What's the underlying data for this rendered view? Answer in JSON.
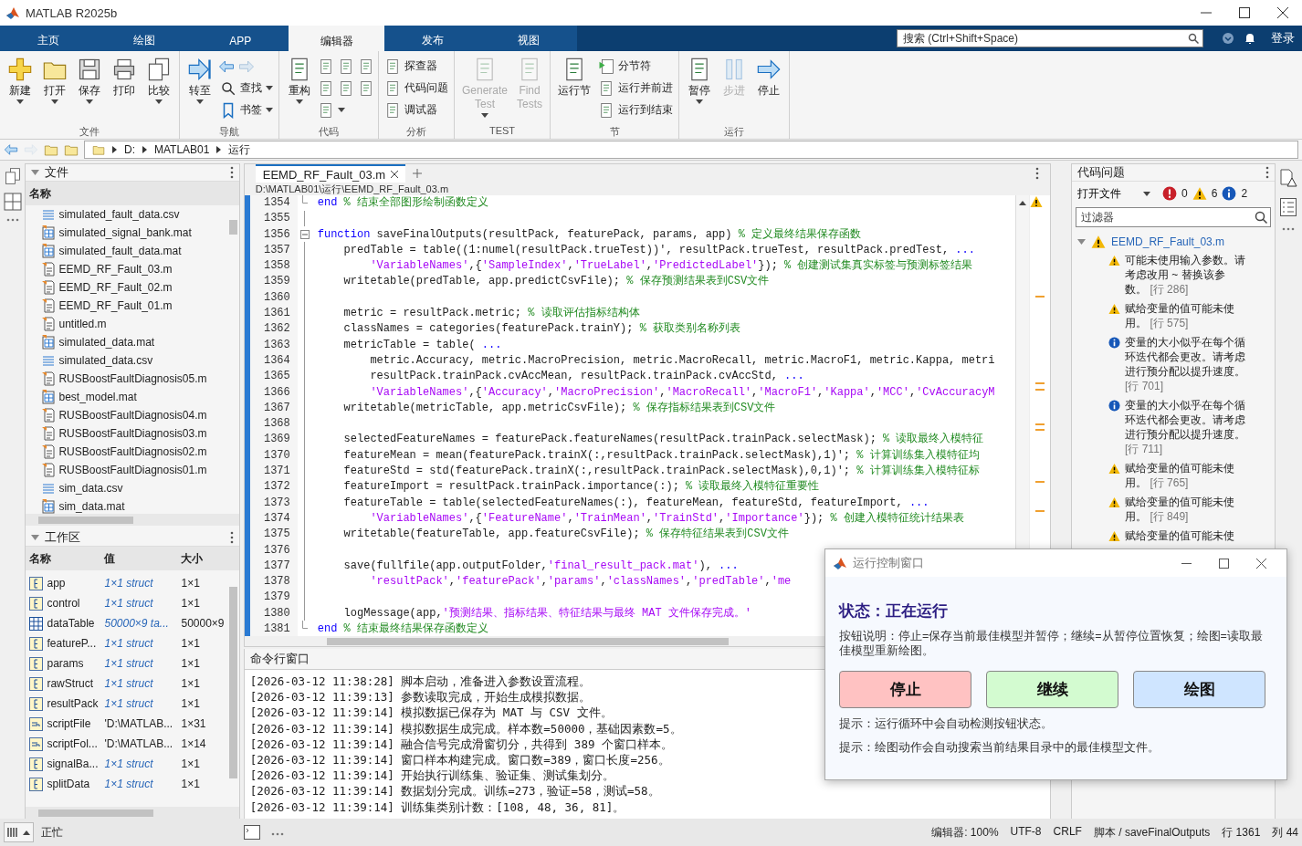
{
  "window": {
    "title": "MATLAB R2025b"
  },
  "tabs": [
    {
      "label": "主页",
      "selected": false
    },
    {
      "label": "绘图",
      "selected": false
    },
    {
      "label": "APP",
      "selected": false
    },
    {
      "label": "编辑器",
      "selected": true
    },
    {
      "label": "发布",
      "selected": false
    },
    {
      "label": "视图",
      "selected": false
    }
  ],
  "search": {
    "placeholder": "搜索 (Ctrl+Shift+Space)"
  },
  "login": "登录",
  "toolstrip": [
    {
      "label": "文件",
      "items": [
        {
          "kind": "big",
          "label": "新建",
          "dropdown": true,
          "disabled": false
        },
        {
          "kind": "big",
          "label": "打开",
          "dropdown": true,
          "disabled": false
        },
        {
          "kind": "big",
          "label": "保存",
          "dropdown": true,
          "disabled": false
        },
        {
          "kind": "big",
          "label": "打印",
          "dropdown": false,
          "disabled": false
        },
        {
          "kind": "big",
          "label": "比较",
          "dropdown": true,
          "disabled": false
        }
      ]
    },
    {
      "label": "导航",
      "items": [
        {
          "kind": "big",
          "label": "转至",
          "dropdown": true,
          "disabled": false
        },
        {
          "kind": "stack",
          "rows": [
            {
              "kind": "icon-pair"
            },
            {
              "kind": "small",
              "label": "查找",
              "dropdown": true
            },
            {
              "kind": "small",
              "label": "书签",
              "dropdown": true
            }
          ]
        }
      ]
    },
    {
      "label": "代码",
      "items": [
        {
          "kind": "big",
          "label": "重构",
          "dropdown": true,
          "disabled": false
        },
        {
          "kind": "stack",
          "rows": [
            {
              "kind": "icon-triple"
            },
            {
              "kind": "icon-triple"
            },
            {
              "kind": "icon-dropdown"
            }
          ]
        }
      ]
    },
    {
      "label": "分析",
      "items": [
        {
          "kind": "stack",
          "rows": [
            {
              "kind": "small",
              "label": "探查器",
              "dropdown": false
            },
            {
              "kind": "small",
              "label": "代码问题",
              "dropdown": false
            },
            {
              "kind": "small",
              "label": "调试器",
              "dropdown": false
            }
          ]
        }
      ]
    },
    {
      "label": "TEST",
      "items": [
        {
          "kind": "big",
          "label": "Generate Test",
          "dropdown": true,
          "disabled": true
        },
        {
          "kind": "big",
          "label": "Find Tests",
          "dropdown": false,
          "disabled": true
        }
      ]
    },
    {
      "label": "节",
      "items": [
        {
          "kind": "big",
          "label": "运行节",
          "dropdown": false,
          "disabled": false
        },
        {
          "kind": "stack",
          "rows": [
            {
              "kind": "small",
              "label": "分节符",
              "dropdown": false
            },
            {
              "kind": "small",
              "label": "运行并前进",
              "dropdown": false
            },
            {
              "kind": "small",
              "label": "运行到结束",
              "dropdown": false
            }
          ]
        }
      ]
    },
    {
      "label": "运行",
      "items": [
        {
          "kind": "big",
          "label": "暂停",
          "dropdown": true,
          "disabled": false
        },
        {
          "kind": "big",
          "label": "步进",
          "dropdown": false,
          "disabled": true
        },
        {
          "kind": "big",
          "label": "停止",
          "dropdown": false,
          "disabled": false
        }
      ]
    }
  ],
  "address": [
    "D:",
    "MATLAB01",
    "运行"
  ],
  "files": {
    "title": "文件",
    "column": "名称",
    "items": [
      {
        "name": "simulated_fault_data.csv",
        "kind": "csv"
      },
      {
        "name": "simulated_signal_bank.mat",
        "kind": "mat"
      },
      {
        "name": "simulated_fault_data.mat",
        "kind": "mat"
      },
      {
        "name": "EEMD_RF_Fault_03.m",
        "kind": "script"
      },
      {
        "name": "EEMD_RF_Fault_02.m",
        "kind": "script"
      },
      {
        "name": "EEMD_RF_Fault_01.m",
        "kind": "script"
      },
      {
        "name": "untitled.m",
        "kind": "script"
      },
      {
        "name": "simulated_data.mat",
        "kind": "mat"
      },
      {
        "name": "simulated_data.csv",
        "kind": "csv"
      },
      {
        "name": "RUSBoostFaultDiagnosis05.m",
        "kind": "script"
      },
      {
        "name": "best_model.mat",
        "kind": "mat"
      },
      {
        "name": "RUSBoostFaultDiagnosis04.m",
        "kind": "script"
      },
      {
        "name": "RUSBoostFaultDiagnosis03.m",
        "kind": "script"
      },
      {
        "name": "RUSBoostFaultDiagnosis02.m",
        "kind": "script"
      },
      {
        "name": "RUSBoostFaultDiagnosis01.m",
        "kind": "script"
      },
      {
        "name": "sim_data.csv",
        "kind": "csv"
      },
      {
        "name": "sim_data.mat",
        "kind": "mat"
      }
    ]
  },
  "workspace": {
    "title": "工作区",
    "columns": [
      "名称",
      "值",
      "大小"
    ],
    "rows": [
      {
        "name": "app",
        "value": "1×1 struct",
        "size": "1×1",
        "kind": "struct"
      },
      {
        "name": "control",
        "value": "1×1 struct",
        "size": "1×1",
        "kind": "struct"
      },
      {
        "name": "dataTable",
        "value": "50000×9 ta...",
        "size": "50000×9",
        "kind": "table"
      },
      {
        "name": "featureP...",
        "value": "1×1 struct",
        "size": "1×1",
        "kind": "struct"
      },
      {
        "name": "params",
        "value": "1×1 struct",
        "size": "1×1",
        "kind": "struct"
      },
      {
        "name": "rawStruct",
        "value": "1×1 struct",
        "size": "1×1",
        "kind": "struct"
      },
      {
        "name": "resultPack",
        "value": "1×1 struct",
        "size": "1×1",
        "kind": "struct"
      },
      {
        "name": "scriptFile",
        "value": "'D:\\MATLAB...",
        "size": "1×31",
        "kind": "char"
      },
      {
        "name": "scriptFol...",
        "value": "'D:\\MATLAB...",
        "size": "1×14",
        "kind": "char"
      },
      {
        "name": "signalBa...",
        "value": "1×1 struct",
        "size": "1×1",
        "kind": "struct"
      },
      {
        "name": "splitData",
        "value": "1×1 struct",
        "size": "1×1",
        "kind": "struct"
      }
    ]
  },
  "editor": {
    "tab": "EEMD_RF_Fault_03.m",
    "path": "D:\\MATLAB01\\运行\\EEMD_RF_Fault_03.m",
    "lines": [
      {
        "num": "1354",
        "kind": "block-end",
        "segs": [
          {
            "kind": "keyword",
            "text": "end"
          },
          {
            "kind": "comment",
            "text": " % 结束全部图形绘制函数定义"
          }
        ]
      },
      {
        "num": "1355",
        "kind": "blank"
      },
      {
        "num": "1356",
        "kind": "function-start",
        "segs": [
          {
            "kind": "keyword",
            "text": "function"
          },
          {
            "kind": "plain",
            "text": " saveFinalOutputs(resultPack, featurePack, params, app) "
          },
          {
            "kind": "comment",
            "text": "% 定义最终结果保存函数"
          }
        ]
      },
      {
        "num": "1357",
        "kind": "code",
        "segs": [
          {
            "kind": "plain",
            "text": "    predTable = table((1:numel(resultPack.trueTest))', resultPack.trueTest, resultPack.predTest, "
          },
          {
            "kind": "keyword",
            "text": "..."
          }
        ]
      },
      {
        "num": "1358",
        "kind": "code",
        "segs": [
          {
            "kind": "string",
            "text": "        'VariableNames'"
          },
          {
            "kind": "plain",
            "text": ",{"
          },
          {
            "kind": "string",
            "text": "'SampleIndex'"
          },
          {
            "kind": "plain",
            "text": ","
          },
          {
            "kind": "string",
            "text": "'TrueLabel'"
          },
          {
            "kind": "plain",
            "text": ","
          },
          {
            "kind": "string",
            "text": "'PredictedLabel'"
          },
          {
            "kind": "plain",
            "text": "}); "
          },
          {
            "kind": "comment",
            "text": "% 创建测试集真实标签与预测标签结果"
          }
        ]
      },
      {
        "num": "1359",
        "kind": "code",
        "segs": [
          {
            "kind": "plain",
            "text": "    writetable(predTable, app.predictCsvFile); "
          },
          {
            "kind": "comment",
            "text": "% 保存预测结果表到CSV文件"
          }
        ]
      },
      {
        "num": "1360",
        "kind": "blank"
      },
      {
        "num": "1361",
        "kind": "code",
        "segs": [
          {
            "kind": "plain",
            "text": "    metric = resultPack.metric; "
          },
          {
            "kind": "comment",
            "text": "% 读取评估指标结构体"
          }
        ]
      },
      {
        "num": "1362",
        "kind": "code",
        "segs": [
          {
            "kind": "plain",
            "text": "    classNames = categories(featurePack.trainY); "
          },
          {
            "kind": "comment",
            "text": "% 获取类别名称列表"
          }
        ]
      },
      {
        "num": "1363",
        "kind": "code",
        "segs": [
          {
            "kind": "plain",
            "text": "    metricTable = table( "
          },
          {
            "kind": "keyword",
            "text": "..."
          }
        ]
      },
      {
        "num": "1364",
        "kind": "code",
        "segs": [
          {
            "kind": "plain",
            "text": "        metric.Accuracy, metric.MacroPrecision, metric.MacroRecall, metric.MacroF1, metric.Kappa, metri"
          }
        ]
      },
      {
        "num": "1365",
        "kind": "code",
        "segs": [
          {
            "kind": "plain",
            "text": "        resultPack.trainPack.cvAccMean, resultPack.trainPack.cvAccStd, "
          },
          {
            "kind": "keyword",
            "text": "..."
          }
        ]
      },
      {
        "num": "1366",
        "kind": "code",
        "segs": [
          {
            "kind": "string",
            "text": "        'VariableNames'"
          },
          {
            "kind": "plain",
            "text": ",{"
          },
          {
            "kind": "string",
            "text": "'Accuracy'"
          },
          {
            "kind": "plain",
            "text": ","
          },
          {
            "kind": "string",
            "text": "'MacroPrecision'"
          },
          {
            "kind": "plain",
            "text": ","
          },
          {
            "kind": "string",
            "text": "'MacroRecall'"
          },
          {
            "kind": "plain",
            "text": ","
          },
          {
            "kind": "string",
            "text": "'MacroF1'"
          },
          {
            "kind": "plain",
            "text": ","
          },
          {
            "kind": "string",
            "text": "'Kappa'"
          },
          {
            "kind": "plain",
            "text": ","
          },
          {
            "kind": "string",
            "text": "'MCC'"
          },
          {
            "kind": "plain",
            "text": ","
          },
          {
            "kind": "string",
            "text": "'CvAccuracyM"
          }
        ]
      },
      {
        "num": "1367",
        "kind": "code",
        "segs": [
          {
            "kind": "plain",
            "text": "    writetable(metricTable, app.metricCsvFile); "
          },
          {
            "kind": "comment",
            "text": "% 保存指标结果表到CSV文件"
          }
        ]
      },
      {
        "num": "1368",
        "kind": "blank"
      },
      {
        "num": "1369",
        "kind": "code",
        "segs": [
          {
            "kind": "plain",
            "text": "    selectedFeatureNames = featurePack.featureNames(resultPack.trainPack.selectMask); "
          },
          {
            "kind": "comment",
            "text": "% 读取最终入模特征"
          }
        ]
      },
      {
        "num": "1370",
        "kind": "code",
        "segs": [
          {
            "kind": "plain",
            "text": "    featureMean = mean(featurePack.trainX(:,resultPack.trainPack.selectMask),1)'; "
          },
          {
            "kind": "comment",
            "text": "% 计算训练集入模特征均"
          }
        ]
      },
      {
        "num": "1371",
        "kind": "code",
        "segs": [
          {
            "kind": "plain",
            "text": "    featureStd = std(featurePack.trainX(:,resultPack.trainPack.selectMask),0,1)'; "
          },
          {
            "kind": "comment",
            "text": "% 计算训练集入模特征标"
          }
        ]
      },
      {
        "num": "1372",
        "kind": "code",
        "segs": [
          {
            "kind": "plain",
            "text": "    featureImport = resultPack.trainPack.importance(:); "
          },
          {
            "kind": "comment",
            "text": "% 读取最终入模特征重要性"
          }
        ]
      },
      {
        "num": "1373",
        "kind": "code",
        "segs": [
          {
            "kind": "plain",
            "text": "    featureTable = table(selectedFeatureNames(:), featureMean, featureStd, featureImport, "
          },
          {
            "kind": "keyword",
            "text": "..."
          }
        ]
      },
      {
        "num": "1374",
        "kind": "code",
        "segs": [
          {
            "kind": "string",
            "text": "        'VariableNames'"
          },
          {
            "kind": "plain",
            "text": ",{"
          },
          {
            "kind": "string",
            "text": "'FeatureName'"
          },
          {
            "kind": "plain",
            "text": ","
          },
          {
            "kind": "string",
            "text": "'TrainMean'"
          },
          {
            "kind": "plain",
            "text": ","
          },
          {
            "kind": "string",
            "text": "'TrainStd'"
          },
          {
            "kind": "plain",
            "text": ","
          },
          {
            "kind": "string",
            "text": "'Importance'"
          },
          {
            "kind": "plain",
            "text": "}); "
          },
          {
            "kind": "comment",
            "text": "% 创建入模特征统计结果表"
          }
        ]
      },
      {
        "num": "1375",
        "kind": "code",
        "segs": [
          {
            "kind": "plain",
            "text": "    writetable(featureTable, app.featureCsvFile); "
          },
          {
            "kind": "comment",
            "text": "% 保存特征结果表到CSV文件"
          }
        ]
      },
      {
        "num": "1376",
        "kind": "blank"
      },
      {
        "num": "1377",
        "kind": "code",
        "segs": [
          {
            "kind": "plain",
            "text": "    save(fullfile(app.outputFolder,"
          },
          {
            "kind": "string",
            "text": "'final_result_pack.mat'"
          },
          {
            "kind": "plain",
            "text": "), "
          },
          {
            "kind": "keyword",
            "text": "..."
          }
        ]
      },
      {
        "num": "1378",
        "kind": "code",
        "segs": [
          {
            "kind": "string",
            "text": "        'resultPack'"
          },
          {
            "kind": "plain",
            "text": ","
          },
          {
            "kind": "string",
            "text": "'featurePack'"
          },
          {
            "kind": "plain",
            "text": ","
          },
          {
            "kind": "string",
            "text": "'params'"
          },
          {
            "kind": "plain",
            "text": ","
          },
          {
            "kind": "string",
            "text": "'classNames'"
          },
          {
            "kind": "plain",
            "text": ","
          },
          {
            "kind": "string",
            "text": "'predTable'"
          },
          {
            "kind": "plain",
            "text": ","
          },
          {
            "kind": "string",
            "text": "'me"
          }
        ]
      },
      {
        "num": "1379",
        "kind": "blank"
      },
      {
        "num": "1380",
        "kind": "code",
        "segs": [
          {
            "kind": "plain",
            "text": "    logMessage(app,"
          },
          {
            "kind": "string",
            "text": "'预测结果、指标结果、特征结果与最终 MAT 文件保存完成。'"
          }
        ]
      },
      {
        "num": "1381",
        "kind": "block-end",
        "segs": [
          {
            "kind": "keyword",
            "text": "end"
          },
          {
            "kind": "comment",
            "text": " % 结束最终结果保存函数定义"
          }
        ]
      }
    ]
  },
  "command_window": {
    "title": "命令行窗口",
    "lines": [
      "[2026-03-12 11:38:28] 脚本启动，准备进入参数设置流程。",
      "[2026-03-12 11:39:13] 参数读取完成，开始生成模拟数据。",
      "[2026-03-12 11:39:14] 模拟数据已保存为 MAT 与 CSV 文件。",
      "[2026-03-12 11:39:14] 模拟数据生成完成。样本数=50000，基础因素数=5。",
      "[2026-03-12 11:39:14] 融合信号完成滑窗切分，共得到 389 个窗口样本。",
      "[2026-03-12 11:39:14] 窗口样本构建完成。窗口数=389，窗口长度=256。",
      "[2026-03-12 11:39:14] 开始执行训练集、验证集、测试集划分。",
      "[2026-03-12 11:39:14] 数据划分完成。训练=273，验证=58，测试=58。",
      "[2026-03-12 11:39:14] 训练集类别计数：[108, 48, 36, 81]。"
    ]
  },
  "code_issues": {
    "title": "代码问题",
    "scope": "打开文件",
    "counts": [
      {
        "kind": "error",
        "count": "0"
      },
      {
        "kind": "warning",
        "count": "6"
      },
      {
        "kind": "info",
        "count": "2"
      }
    ],
    "filter_placeholder": "过滤器",
    "file": "EEMD_RF_Fault_03.m",
    "items": [
      {
        "kind": "warning",
        "text": "可能未使用输入参数。请考虑改用 ~ 替换该参数。",
        "line": "[行 286]"
      },
      {
        "kind": "warning",
        "text": "赋给变量的值可能未使用。",
        "line": "[行 575]"
      },
      {
        "kind": "info",
        "text": "变量的大小似乎在每个循环迭代都会更改。请考虑进行预分配以提升速度。",
        "line": "[行 701]"
      },
      {
        "kind": "info",
        "text": "变量的大小似乎在每个循环迭代都会更改。请考虑进行预分配以提升速度。",
        "line": "[行 711]"
      },
      {
        "kind": "warning",
        "text": "赋给变量的值可能未使用。",
        "line": "[行 765]"
      },
      {
        "kind": "warning",
        "text": "赋给变量的值可能未使用。",
        "line": "[行 849]"
      },
      {
        "kind": "warning",
        "text": "赋给变量的值可能未使"
      }
    ]
  },
  "dialog": {
    "title": "运行控制窗口",
    "status": "状态：正在运行",
    "description": "按钮说明：停止=保存当前最佳模型并暂停；继续=从暂停位置恢复；绘图=读取最佳模型重新绘图。",
    "buttons": [
      {
        "label": "停止",
        "color": "#ffc2c2"
      },
      {
        "label": "继续",
        "color": "#d3fbd0"
      },
      {
        "label": "绘图",
        "color": "#cfe5ff"
      }
    ],
    "tips": [
      "提示：运行循环中会自动检测按钮状态。",
      "提示：绘图动作会自动搜索当前结果目录中的最佳模型文件。"
    ]
  },
  "status_bar": {
    "state": "正忙",
    "items": [
      "编辑器: 100%",
      "UTF-8",
      "CRLF",
      "脚本 / saveFinalOutputs",
      "行 1361",
      "列 44"
    ]
  }
}
